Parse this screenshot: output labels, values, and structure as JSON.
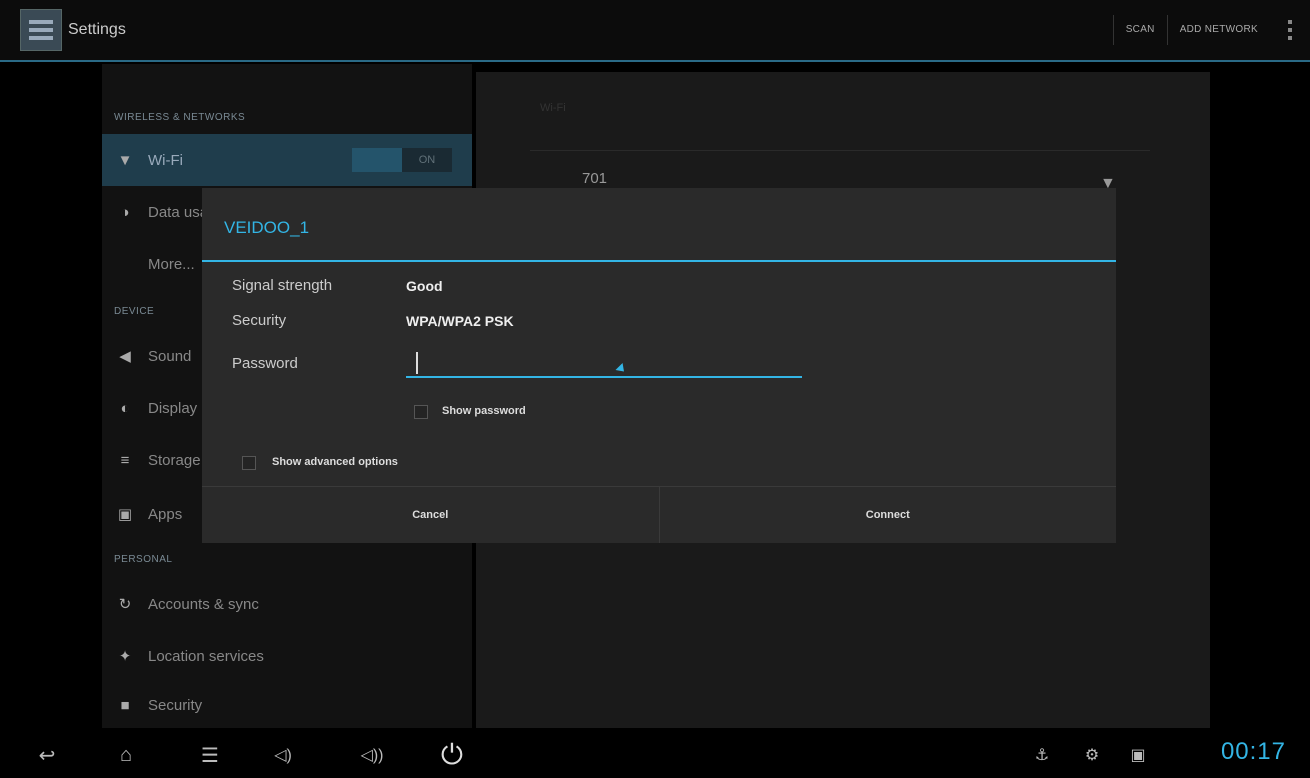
{
  "actionbar": {
    "title": "Settings",
    "actions": [
      "SCAN",
      "ADD NETWORK"
    ]
  },
  "sidebar": {
    "sections": [
      "WIRELESS & NETWORKS",
      "DEVICE",
      "PERSONAL"
    ],
    "items": [
      {
        "label": "Wi-Fi",
        "icon": "wifi-icon"
      },
      {
        "label": "Data usage",
        "icon": "data-usage-icon"
      },
      {
        "label": "More...",
        "icon": ""
      },
      {
        "label": "Sound",
        "icon": "sound-icon"
      },
      {
        "label": "Display",
        "icon": "display-icon"
      },
      {
        "label": "Storage",
        "icon": "storage-icon"
      },
      {
        "label": "Apps",
        "icon": "apps-icon"
      },
      {
        "label": "Accounts & sync",
        "icon": "sync-icon"
      },
      {
        "label": "Location services",
        "icon": "location-icon"
      },
      {
        "label": "Security",
        "icon": "lock-icon"
      }
    ],
    "wifi_toggle": "ON"
  },
  "wifi_panel": {
    "header": "Wi-Fi",
    "network": "701"
  },
  "dialog": {
    "title": "VEIDOO_1",
    "signal_label": "Signal strength",
    "signal_value": "Good",
    "security_label": "Security",
    "security_value": "WPA/WPA2 PSK",
    "password_label": "Password",
    "password_value": "",
    "show_password": "Show password",
    "show_advanced": "Show advanced options",
    "cancel": "Cancel",
    "connect": "Connect"
  },
  "systembar": {
    "clock": "00:17"
  },
  "colors": {
    "accent": "#33b5e5",
    "dialog_bg": "#2a2a2a"
  }
}
